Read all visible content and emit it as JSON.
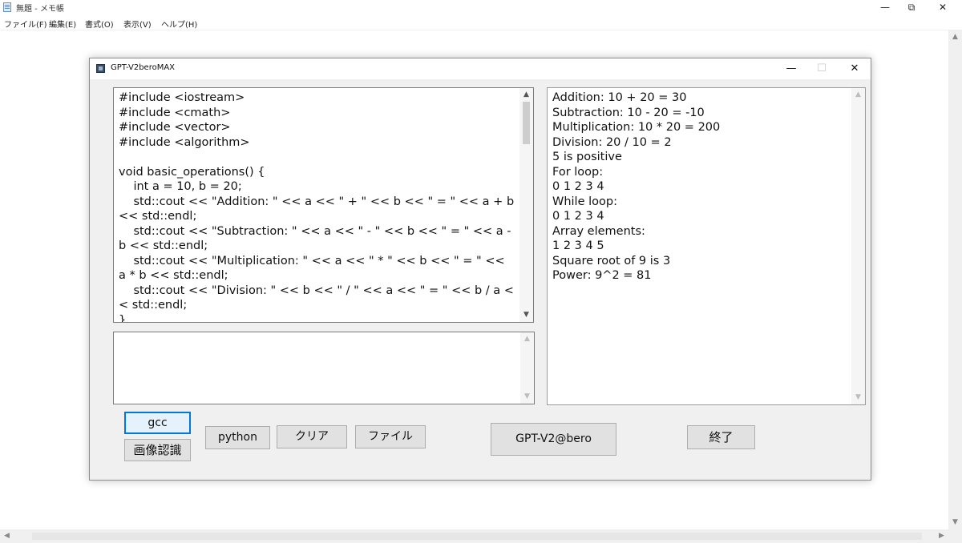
{
  "notepad": {
    "title": "無題 - メモ帳",
    "menu": [
      "ファイル(F)",
      "編集(E)",
      "書式(O)",
      "表示(V)",
      "ヘルプ(H)"
    ],
    "controls": {
      "minimize": "—",
      "restore": "⧉",
      "close": "✕"
    }
  },
  "app": {
    "title": "GPT-V2beroMAX",
    "controls": {
      "minimize": "—",
      "maximize": "☐",
      "close": "✕"
    },
    "code_editor": {
      "lines": [
        "#include <iostream>",
        "#include <cmath>",
        "#include <vector>",
        "#include <algorithm>",
        "",
        "void basic_operations() {",
        "    int a = 10, b = 20;",
        "    std::cout << \"Addition: \" << a << \" + \" << b << \" = \" << a + b << std::endl;",
        "    std::cout << \"Subtraction: \" << a << \" - \" << b << \" = \" << a - b << std::endl;",
        "    std::cout << \"Multiplication: \" << a << \" * \" << b << \" = \" << a * b << std::endl;",
        "    std::cout << \"Division: \" << b << \" / \" << a << \" = \" << b / a << std::endl;",
        "}"
      ]
    },
    "input_box": {
      "value": ""
    },
    "output": {
      "lines": [
        "Addition: 10 + 20 = 30",
        "Subtraction: 10 - 20 = -10",
        "Multiplication: 10 * 20 = 200",
        "Division: 20 / 10 = 2",
        "5 is positive",
        "For loop:",
        "0 1 2 3 4",
        "While loop:",
        "0 1 2 3 4",
        "Array elements:",
        "1 2 3 4 5",
        "Square root of 9 is 3",
        "Power: 9^2 = 81"
      ]
    },
    "buttons": {
      "gcc": "gcc",
      "image_recognition": "画像認識",
      "python": "python",
      "clear": "クリア",
      "file": "ファイル",
      "gpt": "GPT-V2@bero",
      "exit": "終了"
    },
    "scroll_icons": {
      "up": "▲",
      "down": "▼",
      "left": "◀",
      "right": "▶"
    }
  },
  "colors": {
    "focus_border": "#0078d7",
    "button_face": "#e1e1e1",
    "window_bg": "#f0f0f0"
  }
}
